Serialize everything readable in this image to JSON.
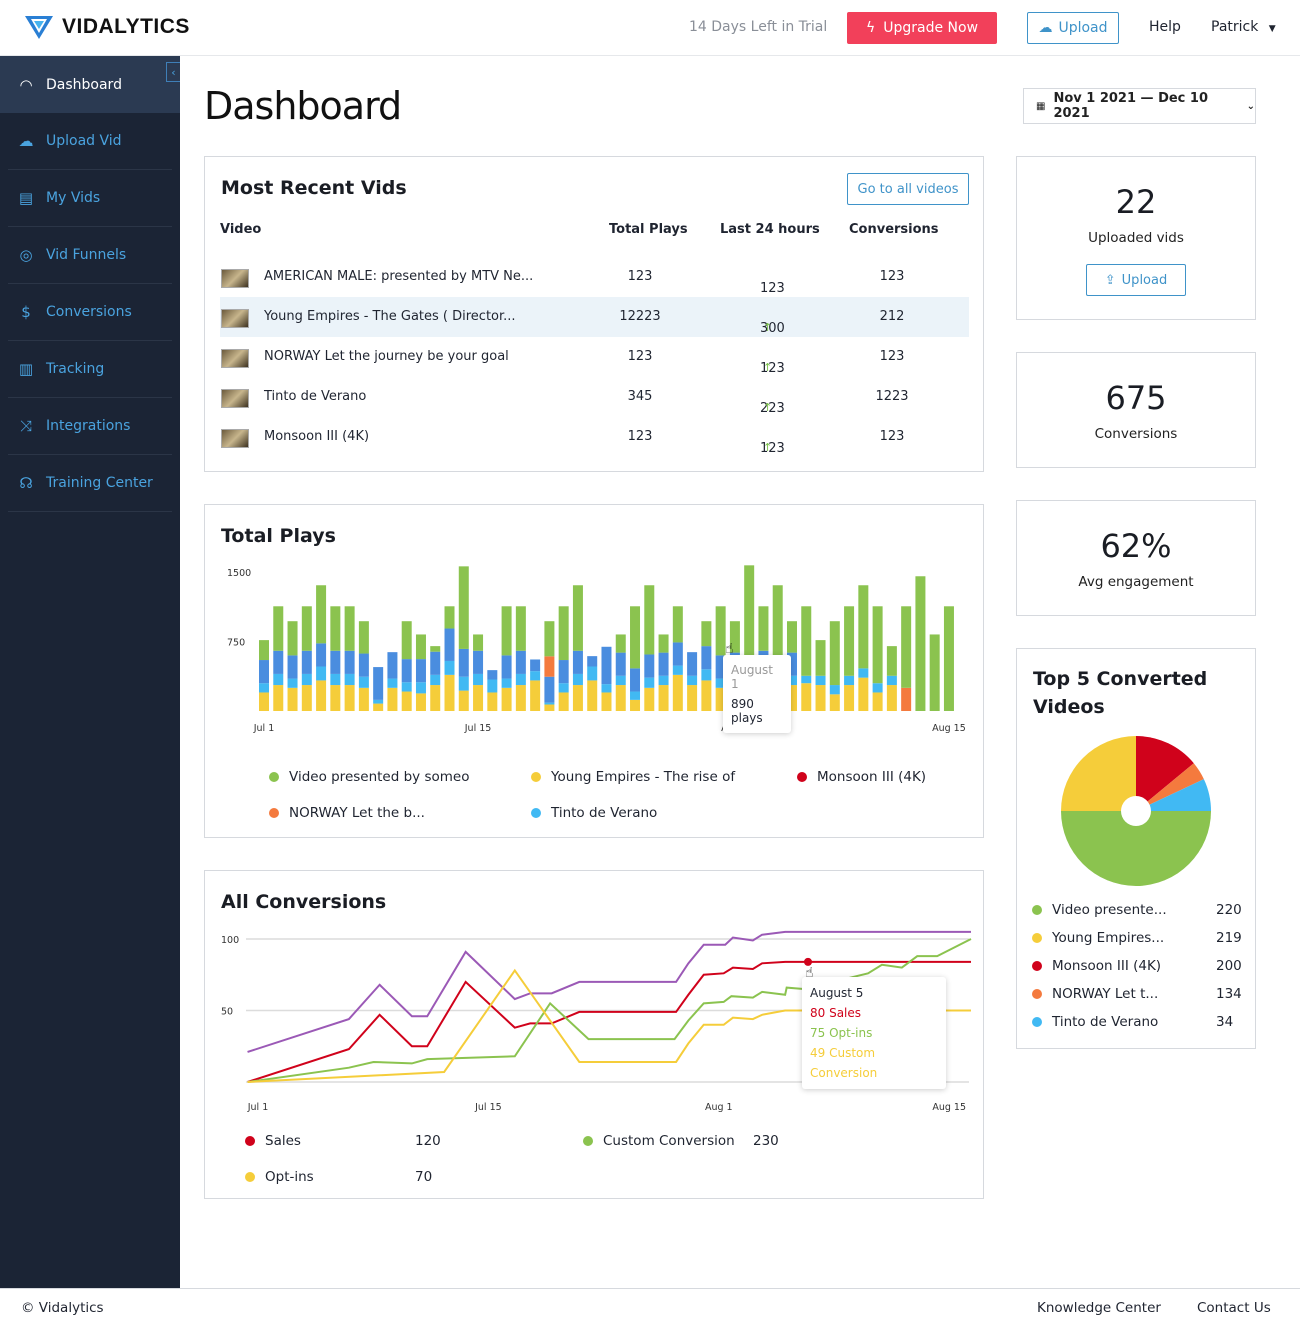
{
  "brand": {
    "name": "VIDALYTICS"
  },
  "topbar": {
    "trial": "14 Days Left in Trial",
    "upgrade": "Upgrade Now",
    "upload": "Upload",
    "help": "Help",
    "user": "Patrick"
  },
  "sidebar": {
    "items": [
      {
        "label": "Dashboard",
        "icon": "gauge-icon",
        "active": true
      },
      {
        "label": "Upload Vid",
        "icon": "cloud-upload-icon"
      },
      {
        "label": "My Vids",
        "icon": "video-list-icon"
      },
      {
        "label": "Vid Funnels",
        "icon": "funnel-target-icon"
      },
      {
        "label": "Conversions",
        "icon": "dollar-circle-icon"
      },
      {
        "label": "Tracking",
        "icon": "bar-chart-icon"
      },
      {
        "label": "Integrations",
        "icon": "shuffle-icon"
      },
      {
        "label": "Training Center",
        "icon": "headset-icon"
      }
    ]
  },
  "page": {
    "title": "Dashboard",
    "date_range": "Nov 1 2021 — Dec 10 2021"
  },
  "recent": {
    "title": "Most Recent Vids",
    "button": "Go to all videos",
    "columns": [
      "Video",
      "Total Plays",
      "Last 24 hours",
      "Conversions"
    ],
    "rows": [
      {
        "video": "AMERICAN MALE: presented by MTV Ne...",
        "plays": "123",
        "last24": "123",
        "up": false,
        "conversions": "123"
      },
      {
        "video": "Young Empires - The Gates ( Director...",
        "plays": "12223",
        "last24": "300",
        "up": true,
        "conversions": "212",
        "highlight": true
      },
      {
        "video": "NORWAY Let the journey be your goal",
        "plays": "123",
        "last24": "123",
        "up": true,
        "conversions": "123"
      },
      {
        "video": "Tinto de Verano",
        "plays": "345",
        "last24": "223",
        "up": true,
        "conversions": "1223"
      },
      {
        "video": "Monsoon III (4K)",
        "plays": "123",
        "last24": "123",
        "up": true,
        "conversions": "123"
      }
    ]
  },
  "stats": [
    {
      "value": "22",
      "label": "Uploaded vids",
      "button": "Upload"
    },
    {
      "value": "675",
      "label": "Conversions"
    },
    {
      "value": "62%",
      "label": "Avg engagement"
    }
  ],
  "chart_data": [
    {
      "type": "bar",
      "stacked": true,
      "title": "Total Plays",
      "ylim": [
        0,
        1500
      ],
      "yticks": [
        750,
        1500
      ],
      "xticks": [
        {
          "label": "Jul 1",
          "index": 0
        },
        {
          "label": "Jul 15",
          "index": 15
        },
        {
          "label": "Aug 1",
          "index": 33
        },
        {
          "label": "Aug 15",
          "index": 48
        }
      ],
      "series": [
        {
          "name": "Young Empires - The rise of",
          "color": "#f5cd3a",
          "values": [
            200,
            280,
            250,
            280,
            330,
            280,
            280,
            250,
            80,
            250,
            210,
            190,
            280,
            390,
            220,
            280,
            200,
            250,
            280,
            330,
            70,
            200,
            280,
            330,
            200,
            280,
            120,
            250,
            280,
            390,
            280,
            330,
            250,
            280,
            250,
            280,
            250,
            280,
            300,
            280,
            180,
            280,
            360,
            200,
            280,
            0,
            0,
            0,
            0
          ]
        },
        {
          "name": "Tinto de Verano",
          "color": "#41b9f3",
          "values": [
            100,
            120,
            100,
            120,
            150,
            120,
            120,
            120,
            40,
            100,
            100,
            120,
            110,
            150,
            150,
            120,
            140,
            100,
            120,
            100,
            20,
            100,
            120,
            150,
            90,
            100,
            90,
            110,
            100,
            100,
            100,
            120,
            100,
            100,
            100,
            120,
            100,
            100,
            80,
            100,
            100,
            100,
            100,
            100,
            100,
            0,
            0,
            0,
            0
          ]
        },
        {
          "color": "#4a8ddf",
          "values": [
            250,
            250,
            250,
            250,
            250,
            250,
            250,
            250,
            354,
            285,
            250,
            250,
            250,
            350,
            300,
            250,
            101,
            250,
            250,
            126,
            280,
            250,
            250,
            112,
            403,
            250,
            250,
            250,
            250,
            250,
            255,
            250,
            250,
            250,
            250,
            250,
            250,
            250,
            0,
            0,
            0,
            0,
            0,
            0,
            0,
            0,
            0,
            0,
            0
          ]
        },
        {
          "name": "NORWAY Let the b...",
          "color": "#f47a3e",
          "values": [
            0,
            0,
            0,
            0,
            0,
            0,
            0,
            0,
            0,
            0,
            0,
            0,
            0,
            0,
            0,
            0,
            0,
            0,
            0,
            0,
            220,
            0,
            0,
            0,
            0,
            0,
            0,
            0,
            0,
            0,
            0,
            0,
            0,
            0,
            0,
            0,
            0,
            0,
            0,
            0,
            0,
            0,
            0,
            0,
            0,
            250,
            0,
            0,
            0
          ]
        },
        {
          "name": "Video presented by someo",
          "color": "#8bc34f",
          "values": [
            215,
            480,
            369,
            480,
            627,
            480,
            480,
            349,
            0,
            0,
            409,
            266,
            60,
            240,
            891,
            176,
            0,
            530,
            480,
            0,
            379,
            580,
            707,
            0,
            0,
            196,
            670,
            747,
            196,
            390,
            0,
            269,
            530,
            339,
            972,
            480,
            757,
            339,
            750,
            385,
            689,
            750,
            897,
            830,
            320,
            880,
            1454,
            826,
            1130
          ]
        },
        {
          "name": "Monsoon III (4K)",
          "color": "#d0021b",
          "values": []
        }
      ],
      "legend": [
        "Video presented by someo",
        "Young Empires - The rise of",
        "Monsoon III (4K)",
        "NORWAY Let the b...",
        "Tinto de Verano"
      ],
      "tooltip": {
        "date": "August 1",
        "value": "890 plays"
      }
    },
    {
      "type": "line",
      "title": "All Conversions",
      "ylim": [
        0,
        100
      ],
      "yticks": [
        50,
        100
      ],
      "xticks": [
        {
          "label": "Jul 1",
          "x": 0
        },
        {
          "label": "Jul 15",
          "x": 15
        },
        {
          "label": "Aug 1",
          "x": 30
        },
        {
          "label": "Aug 15",
          "x": 45
        }
      ],
      "series": [
        {
          "color": "#9b59b6",
          "points": [
            [
              0.1,
              21
            ],
            [
              6.7,
              44
            ],
            [
              8.7,
              68
            ],
            [
              10.8,
              46
            ],
            [
              11.8,
              46
            ],
            [
              14.3,
              91
            ],
            [
              17.5,
              58
            ],
            [
              18.5,
              62
            ],
            [
              19.9,
              62
            ],
            [
              21.7,
              70
            ],
            [
              28,
              70
            ],
            [
              28.8,
              83
            ],
            [
              29.8,
              96
            ],
            [
              31.2,
              96
            ],
            [
              31.7,
              101
            ],
            [
              33,
              99
            ],
            [
              33.6,
              103
            ],
            [
              35.1,
              105
            ],
            [
              47.2,
              105
            ]
          ]
        },
        {
          "name": "Sales",
          "color": "#d0021b",
          "points": [
            [
              0.1,
              0
            ],
            [
              6.7,
              23
            ],
            [
              8.7,
              47
            ],
            [
              10.8,
              25
            ],
            [
              11.8,
              25
            ],
            [
              14.3,
              70
            ],
            [
              17.5,
              38
            ],
            [
              18.5,
              41
            ],
            [
              19.9,
              41
            ],
            [
              21.7,
              49
            ],
            [
              28,
              49
            ],
            [
              28.8,
              61
            ],
            [
              29.8,
              75
            ],
            [
              31.1,
              76
            ],
            [
              31.7,
              80
            ],
            [
              33,
              79
            ],
            [
              33.6,
              83
            ],
            [
              35.1,
              84
            ],
            [
              47.2,
              84
            ]
          ]
        },
        {
          "name": "Custom Conversion",
          "color": "#8bc34f",
          "points": [
            [
              0.1,
              0
            ],
            [
              6.7,
              10
            ],
            [
              8.3,
              14
            ],
            [
              10.8,
              13
            ],
            [
              11.8,
              16
            ],
            [
              17.5,
              18
            ],
            [
              19.8,
              55
            ],
            [
              22.3,
              30
            ],
            [
              27.9,
              30
            ],
            [
              28.8,
              43
            ],
            [
              29.8,
              55
            ],
            [
              31.1,
              56
            ],
            [
              31.6,
              60
            ],
            [
              33,
              59
            ],
            [
              33.6,
              63
            ],
            [
              35.1,
              61
            ],
            [
              35.2,
              66
            ],
            [
              36.3,
              65
            ],
            [
              40.5,
              76
            ],
            [
              41.4,
              82
            ],
            [
              42.7,
              80
            ],
            [
              43.7,
              88
            ],
            [
              45,
              88
            ],
            [
              47.2,
              100
            ]
          ]
        },
        {
          "name": "Opt-ins",
          "color": "#f5cd3a",
          "points": [
            [
              0.1,
              0
            ],
            [
              12.9,
              7
            ],
            [
              17.5,
              78
            ],
            [
              21.7,
              14
            ],
            [
              28,
              14
            ],
            [
              28.8,
              27
            ],
            [
              29.8,
              40
            ],
            [
              31.1,
              40
            ],
            [
              31.7,
              45
            ],
            [
              33,
              44
            ],
            [
              33.6,
              47
            ],
            [
              35.1,
              50
            ],
            [
              47.2,
              50
            ]
          ]
        }
      ],
      "legend": [
        {
          "name": "Sales",
          "value": "120",
          "color": "#d0021b"
        },
        {
          "name": "Custom Conversion",
          "value": "230",
          "color": "#8bc34f"
        },
        {
          "name": "Opt-ins",
          "value": "70",
          "color": "#f5cd3a"
        }
      ],
      "tooltip": {
        "date": "August 5",
        "lines": [
          {
            "text": "80 Sales",
            "color": "#d0021b"
          },
          {
            "text": "75 Opt-ins",
            "color": "#8bc34f"
          },
          {
            "text": "49 Custom Conversion",
            "color": "#f5cd3a"
          }
        ]
      }
    },
    {
      "type": "pie",
      "title": "Top 5 Converted Videos",
      "slices": [
        {
          "name": "Video presente...",
          "value": "220",
          "share_percent": 50,
          "color": "#8bc34f"
        },
        {
          "name": "Young Empires...",
          "value": "219",
          "share_percent": 25,
          "color": "#f5cd3a"
        },
        {
          "name": "Monsoon III (4K)",
          "value": "200",
          "share_percent": 14,
          "color": "#d0021b"
        },
        {
          "name": "NORWAY Let t...",
          "value": "134",
          "share_percent": 4,
          "color": "#f47a3e"
        },
        {
          "name": "Tinto de Verano",
          "value": "34",
          "share_percent": 7,
          "color": "#41b9f3"
        }
      ]
    }
  ],
  "footer": {
    "copyright": "© Vidalytics",
    "links": [
      "Knowledge Center",
      "Contact Us"
    ]
  },
  "colors": {
    "sidebar": "#1b2435",
    "accent": "#3f93c9",
    "upgrade": "#f2405a"
  }
}
